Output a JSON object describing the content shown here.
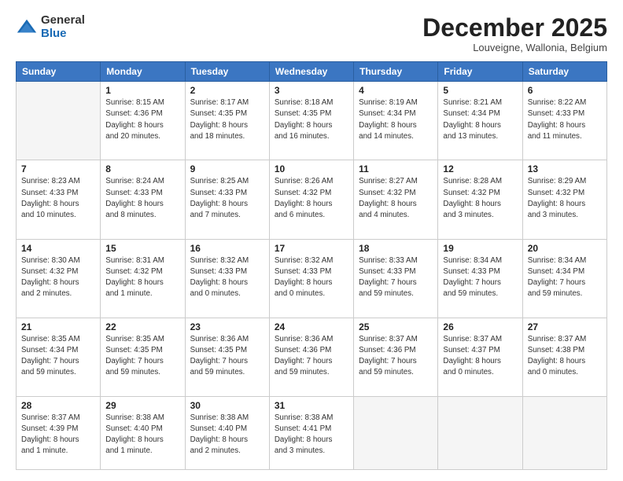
{
  "logo": {
    "general": "General",
    "blue": "Blue"
  },
  "header": {
    "month": "December 2025",
    "location": "Louveigne, Wallonia, Belgium"
  },
  "days_of_week": [
    "Sunday",
    "Monday",
    "Tuesday",
    "Wednesday",
    "Thursday",
    "Friday",
    "Saturday"
  ],
  "weeks": [
    [
      {
        "day": "",
        "lines": []
      },
      {
        "day": "1",
        "lines": [
          "Sunrise: 8:15 AM",
          "Sunset: 4:36 PM",
          "Daylight: 8 hours",
          "and 20 minutes."
        ]
      },
      {
        "day": "2",
        "lines": [
          "Sunrise: 8:17 AM",
          "Sunset: 4:35 PM",
          "Daylight: 8 hours",
          "and 18 minutes."
        ]
      },
      {
        "day": "3",
        "lines": [
          "Sunrise: 8:18 AM",
          "Sunset: 4:35 PM",
          "Daylight: 8 hours",
          "and 16 minutes."
        ]
      },
      {
        "day": "4",
        "lines": [
          "Sunrise: 8:19 AM",
          "Sunset: 4:34 PM",
          "Daylight: 8 hours",
          "and 14 minutes."
        ]
      },
      {
        "day": "5",
        "lines": [
          "Sunrise: 8:21 AM",
          "Sunset: 4:34 PM",
          "Daylight: 8 hours",
          "and 13 minutes."
        ]
      },
      {
        "day": "6",
        "lines": [
          "Sunrise: 8:22 AM",
          "Sunset: 4:33 PM",
          "Daylight: 8 hours",
          "and 11 minutes."
        ]
      }
    ],
    [
      {
        "day": "7",
        "lines": [
          "Sunrise: 8:23 AM",
          "Sunset: 4:33 PM",
          "Daylight: 8 hours",
          "and 10 minutes."
        ]
      },
      {
        "day": "8",
        "lines": [
          "Sunrise: 8:24 AM",
          "Sunset: 4:33 PM",
          "Daylight: 8 hours",
          "and 8 minutes."
        ]
      },
      {
        "day": "9",
        "lines": [
          "Sunrise: 8:25 AM",
          "Sunset: 4:33 PM",
          "Daylight: 8 hours",
          "and 7 minutes."
        ]
      },
      {
        "day": "10",
        "lines": [
          "Sunrise: 8:26 AM",
          "Sunset: 4:32 PM",
          "Daylight: 8 hours",
          "and 6 minutes."
        ]
      },
      {
        "day": "11",
        "lines": [
          "Sunrise: 8:27 AM",
          "Sunset: 4:32 PM",
          "Daylight: 8 hours",
          "and 4 minutes."
        ]
      },
      {
        "day": "12",
        "lines": [
          "Sunrise: 8:28 AM",
          "Sunset: 4:32 PM",
          "Daylight: 8 hours",
          "and 3 minutes."
        ]
      },
      {
        "day": "13",
        "lines": [
          "Sunrise: 8:29 AM",
          "Sunset: 4:32 PM",
          "Daylight: 8 hours",
          "and 3 minutes."
        ]
      }
    ],
    [
      {
        "day": "14",
        "lines": [
          "Sunrise: 8:30 AM",
          "Sunset: 4:32 PM",
          "Daylight: 8 hours",
          "and 2 minutes."
        ]
      },
      {
        "day": "15",
        "lines": [
          "Sunrise: 8:31 AM",
          "Sunset: 4:32 PM",
          "Daylight: 8 hours",
          "and 1 minute."
        ]
      },
      {
        "day": "16",
        "lines": [
          "Sunrise: 8:32 AM",
          "Sunset: 4:33 PM",
          "Daylight: 8 hours",
          "and 0 minutes."
        ]
      },
      {
        "day": "17",
        "lines": [
          "Sunrise: 8:32 AM",
          "Sunset: 4:33 PM",
          "Daylight: 8 hours",
          "and 0 minutes."
        ]
      },
      {
        "day": "18",
        "lines": [
          "Sunrise: 8:33 AM",
          "Sunset: 4:33 PM",
          "Daylight: 7 hours",
          "and 59 minutes."
        ]
      },
      {
        "day": "19",
        "lines": [
          "Sunrise: 8:34 AM",
          "Sunset: 4:33 PM",
          "Daylight: 7 hours",
          "and 59 minutes."
        ]
      },
      {
        "day": "20",
        "lines": [
          "Sunrise: 8:34 AM",
          "Sunset: 4:34 PM",
          "Daylight: 7 hours",
          "and 59 minutes."
        ]
      }
    ],
    [
      {
        "day": "21",
        "lines": [
          "Sunrise: 8:35 AM",
          "Sunset: 4:34 PM",
          "Daylight: 7 hours",
          "and 59 minutes."
        ]
      },
      {
        "day": "22",
        "lines": [
          "Sunrise: 8:35 AM",
          "Sunset: 4:35 PM",
          "Daylight: 7 hours",
          "and 59 minutes."
        ]
      },
      {
        "day": "23",
        "lines": [
          "Sunrise: 8:36 AM",
          "Sunset: 4:35 PM",
          "Daylight: 7 hours",
          "and 59 minutes."
        ]
      },
      {
        "day": "24",
        "lines": [
          "Sunrise: 8:36 AM",
          "Sunset: 4:36 PM",
          "Daylight: 7 hours",
          "and 59 minutes."
        ]
      },
      {
        "day": "25",
        "lines": [
          "Sunrise: 8:37 AM",
          "Sunset: 4:36 PM",
          "Daylight: 7 hours",
          "and 59 minutes."
        ]
      },
      {
        "day": "26",
        "lines": [
          "Sunrise: 8:37 AM",
          "Sunset: 4:37 PM",
          "Daylight: 8 hours",
          "and 0 minutes."
        ]
      },
      {
        "day": "27",
        "lines": [
          "Sunrise: 8:37 AM",
          "Sunset: 4:38 PM",
          "Daylight: 8 hours",
          "and 0 minutes."
        ]
      }
    ],
    [
      {
        "day": "28",
        "lines": [
          "Sunrise: 8:37 AM",
          "Sunset: 4:39 PM",
          "Daylight: 8 hours",
          "and 1 minute."
        ]
      },
      {
        "day": "29",
        "lines": [
          "Sunrise: 8:38 AM",
          "Sunset: 4:40 PM",
          "Daylight: 8 hours",
          "and 1 minute."
        ]
      },
      {
        "day": "30",
        "lines": [
          "Sunrise: 8:38 AM",
          "Sunset: 4:40 PM",
          "Daylight: 8 hours",
          "and 2 minutes."
        ]
      },
      {
        "day": "31",
        "lines": [
          "Sunrise: 8:38 AM",
          "Sunset: 4:41 PM",
          "Daylight: 8 hours",
          "and 3 minutes."
        ]
      },
      {
        "day": "",
        "lines": []
      },
      {
        "day": "",
        "lines": []
      },
      {
        "day": "",
        "lines": []
      }
    ]
  ]
}
